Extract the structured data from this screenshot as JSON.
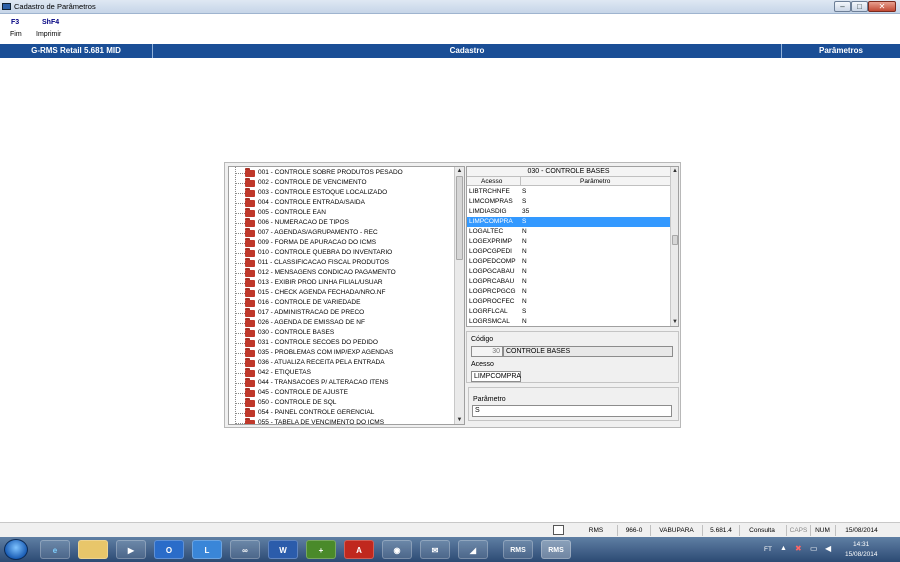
{
  "window": {
    "title": "Cadastro de Parâmetros"
  },
  "function_keys": [
    {
      "key": "F3",
      "label": "Fim"
    },
    {
      "key": "ShF4",
      "label": "Imprimir"
    }
  ],
  "header": {
    "app": "G-RMS Retail 5.681 MID",
    "module": "Cadastro",
    "section": "Parâmetros"
  },
  "tree": {
    "items": [
      "001 - CONTROLE SOBRE PRODUTOS PESADO",
      "002 - CONTROLE DE VENCIMENTO",
      "003 - CONTROLE ESTOQUE LOCALIZADO",
      "004 - CONTROLE ENTRADA/SAIDA",
      "005 - CONTROLE EAN",
      "006 - NUMERACAO DE TIPOS",
      "007 - AGENDAS/AGRUPAMENTO - REC",
      "009 - FORMA DE APURACAO DO ICMS",
      "010 - CONTROLE QUEBRA DO INVENTARIO",
      "011 - CLASSIFICACAO FISCAL PRODUTOS",
      "012 - MENSAGENS CONDICAO PAGAMENTO",
      "013 - EXIBIR PROD LINHA FILIAL/USUAR",
      "015 - CHECK AGENDA FECHADA/NRO.NF",
      "016 - CONTROLE DE VARIEDADE",
      "017 - ADMINISTRACAO DE PRECO",
      "026 - AGENDA DE EMISSAO DE NF",
      "030 - CONTROLE BASES",
      "031 - CONTROLE SECOES DO PEDIDO",
      "035 - PROBLEMAS COM IMP/EXP AGENDAS",
      "036 - ATUALIZA RECEITA PELA ENTRADA",
      "042 - ETIQUETAS",
      "044 - TRANSACOES P/ ALTERACAO ITENS",
      "045 - CONTROLE DE AJUSTE",
      "050 - CONTROLE DE SQL",
      "054 - PAINEL CONTROLE GERENCIAL",
      "055 - TABELA DE VENCIMENTO DO ICMS"
    ]
  },
  "params": {
    "title": "030 - CONTROLE BASES",
    "col_access": "Acesso",
    "col_param": "Parâmetro",
    "rows": [
      {
        "k": "LIBTRCHNFE",
        "v": "S"
      },
      {
        "k": "LIMCOMPRAS",
        "v": "S"
      },
      {
        "k": "LIMDIASDIG",
        "v": "35"
      },
      {
        "k": "LIMPCOMPRA",
        "v": "S"
      },
      {
        "k": "LOGALTEC",
        "v": "N"
      },
      {
        "k": "LOGEXPRIMP",
        "v": "N"
      },
      {
        "k": "LOGPCGPEDI",
        "v": "N"
      },
      {
        "k": "LOGPEDCOMP",
        "v": "N"
      },
      {
        "k": "LOGPGCABAU",
        "v": "N"
      },
      {
        "k": "LOGPRCABAU",
        "v": "N"
      },
      {
        "k": "LOGPRCPGCG",
        "v": "N"
      },
      {
        "k": "LOGPROCFEC",
        "v": "N"
      },
      {
        "k": "LOGRFLCAL",
        "v": "S"
      },
      {
        "k": "LOGRSMCAL",
        "v": "N"
      }
    ],
    "selected_row": 3
  },
  "form": {
    "codigo_label": "Código",
    "codigo_value": "30",
    "codigo_desc": "CONTROLE BASES",
    "acesso_label": "Acesso",
    "acesso_value": "LIMPCOMPRA",
    "parametro_label": "Parâmetro",
    "parametro_value": "S"
  },
  "status": {
    "system": "RMS",
    "code": "966-0",
    "user": "VABUPARA",
    "version": "5.681.4",
    "mode": "Consulta",
    "caps": "CAPS",
    "num": "NUM",
    "date": "15/08/2014"
  },
  "taskbar": {
    "rms1": "RMS",
    "rms2": "RMS",
    "tray_lang": "FT",
    "time": "14:31",
    "date": "15/08/2014"
  }
}
